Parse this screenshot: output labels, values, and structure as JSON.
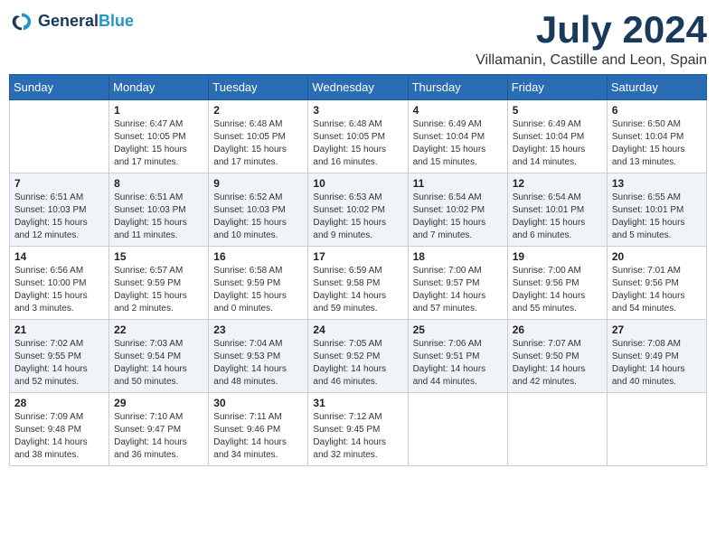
{
  "header": {
    "logo_line1": "General",
    "logo_line2": "Blue",
    "month_title": "July 2024",
    "location": "Villamanin, Castille and Leon, Spain"
  },
  "days_of_week": [
    "Sunday",
    "Monday",
    "Tuesday",
    "Wednesday",
    "Thursday",
    "Friday",
    "Saturday"
  ],
  "weeks": [
    [
      {
        "day": "",
        "info": ""
      },
      {
        "day": "1",
        "info": "Sunrise: 6:47 AM\nSunset: 10:05 PM\nDaylight: 15 hours\nand 17 minutes."
      },
      {
        "day": "2",
        "info": "Sunrise: 6:48 AM\nSunset: 10:05 PM\nDaylight: 15 hours\nand 17 minutes."
      },
      {
        "day": "3",
        "info": "Sunrise: 6:48 AM\nSunset: 10:05 PM\nDaylight: 15 hours\nand 16 minutes."
      },
      {
        "day": "4",
        "info": "Sunrise: 6:49 AM\nSunset: 10:04 PM\nDaylight: 15 hours\nand 15 minutes."
      },
      {
        "day": "5",
        "info": "Sunrise: 6:49 AM\nSunset: 10:04 PM\nDaylight: 15 hours\nand 14 minutes."
      },
      {
        "day": "6",
        "info": "Sunrise: 6:50 AM\nSunset: 10:04 PM\nDaylight: 15 hours\nand 13 minutes."
      }
    ],
    [
      {
        "day": "7",
        "info": "Sunrise: 6:51 AM\nSunset: 10:03 PM\nDaylight: 15 hours\nand 12 minutes."
      },
      {
        "day": "8",
        "info": "Sunrise: 6:51 AM\nSunset: 10:03 PM\nDaylight: 15 hours\nand 11 minutes."
      },
      {
        "day": "9",
        "info": "Sunrise: 6:52 AM\nSunset: 10:03 PM\nDaylight: 15 hours\nand 10 minutes."
      },
      {
        "day": "10",
        "info": "Sunrise: 6:53 AM\nSunset: 10:02 PM\nDaylight: 15 hours\nand 9 minutes."
      },
      {
        "day": "11",
        "info": "Sunrise: 6:54 AM\nSunset: 10:02 PM\nDaylight: 15 hours\nand 7 minutes."
      },
      {
        "day": "12",
        "info": "Sunrise: 6:54 AM\nSunset: 10:01 PM\nDaylight: 15 hours\nand 6 minutes."
      },
      {
        "day": "13",
        "info": "Sunrise: 6:55 AM\nSunset: 10:01 PM\nDaylight: 15 hours\nand 5 minutes."
      }
    ],
    [
      {
        "day": "14",
        "info": "Sunrise: 6:56 AM\nSunset: 10:00 PM\nDaylight: 15 hours\nand 3 minutes."
      },
      {
        "day": "15",
        "info": "Sunrise: 6:57 AM\nSunset: 9:59 PM\nDaylight: 15 hours\nand 2 minutes."
      },
      {
        "day": "16",
        "info": "Sunrise: 6:58 AM\nSunset: 9:59 PM\nDaylight: 15 hours\nand 0 minutes."
      },
      {
        "day": "17",
        "info": "Sunrise: 6:59 AM\nSunset: 9:58 PM\nDaylight: 14 hours\nand 59 minutes."
      },
      {
        "day": "18",
        "info": "Sunrise: 7:00 AM\nSunset: 9:57 PM\nDaylight: 14 hours\nand 57 minutes."
      },
      {
        "day": "19",
        "info": "Sunrise: 7:00 AM\nSunset: 9:56 PM\nDaylight: 14 hours\nand 55 minutes."
      },
      {
        "day": "20",
        "info": "Sunrise: 7:01 AM\nSunset: 9:56 PM\nDaylight: 14 hours\nand 54 minutes."
      }
    ],
    [
      {
        "day": "21",
        "info": "Sunrise: 7:02 AM\nSunset: 9:55 PM\nDaylight: 14 hours\nand 52 minutes."
      },
      {
        "day": "22",
        "info": "Sunrise: 7:03 AM\nSunset: 9:54 PM\nDaylight: 14 hours\nand 50 minutes."
      },
      {
        "day": "23",
        "info": "Sunrise: 7:04 AM\nSunset: 9:53 PM\nDaylight: 14 hours\nand 48 minutes."
      },
      {
        "day": "24",
        "info": "Sunrise: 7:05 AM\nSunset: 9:52 PM\nDaylight: 14 hours\nand 46 minutes."
      },
      {
        "day": "25",
        "info": "Sunrise: 7:06 AM\nSunset: 9:51 PM\nDaylight: 14 hours\nand 44 minutes."
      },
      {
        "day": "26",
        "info": "Sunrise: 7:07 AM\nSunset: 9:50 PM\nDaylight: 14 hours\nand 42 minutes."
      },
      {
        "day": "27",
        "info": "Sunrise: 7:08 AM\nSunset: 9:49 PM\nDaylight: 14 hours\nand 40 minutes."
      }
    ],
    [
      {
        "day": "28",
        "info": "Sunrise: 7:09 AM\nSunset: 9:48 PM\nDaylight: 14 hours\nand 38 minutes."
      },
      {
        "day": "29",
        "info": "Sunrise: 7:10 AM\nSunset: 9:47 PM\nDaylight: 14 hours\nand 36 minutes."
      },
      {
        "day": "30",
        "info": "Sunrise: 7:11 AM\nSunset: 9:46 PM\nDaylight: 14 hours\nand 34 minutes."
      },
      {
        "day": "31",
        "info": "Sunrise: 7:12 AM\nSunset: 9:45 PM\nDaylight: 14 hours\nand 32 minutes."
      },
      {
        "day": "",
        "info": ""
      },
      {
        "day": "",
        "info": ""
      },
      {
        "day": "",
        "info": ""
      }
    ]
  ]
}
